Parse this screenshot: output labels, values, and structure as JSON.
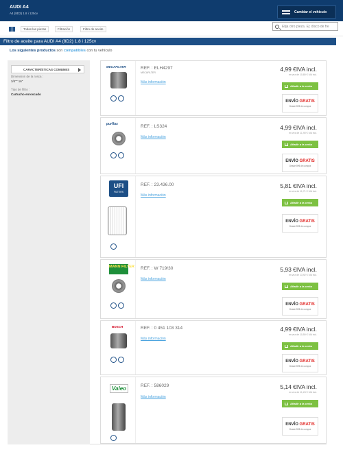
{
  "header": {
    "car_title": "AUDI A4",
    "car_subtitle": "A4 (8D2) 1.8 i 125cv",
    "change_vehicle_label": "Cambiar el vehículo"
  },
  "toolbar": {
    "chips": [
      "Todas las piezas",
      "Filtración",
      "Filtro de aceite"
    ],
    "search_placeholder": "Elija otro pieza. Ej: disco de fre"
  },
  "page_title": "Filtro de aceite para AUDI A4 (8D2) 1.8 i 125cv",
  "compat": {
    "prefix": "Los siguientes productos",
    "mid": "son",
    "highlight": "compatibles",
    "suffix": "con tu vehículo"
  },
  "sidebar": {
    "panel_title": "CARACTERÍSTICAS COMUNES",
    "specs": [
      {
        "label": "Dimensión de la rosca :",
        "value": "3/4\"\" 16\""
      },
      {
        "label": "Tipo de filtro :",
        "value": "Cartucho enroscado"
      }
    ]
  },
  "common_labels": {
    "more_info": "Más información",
    "add_to_cart": "Añadir a la cesta",
    "shipping_word": "ENVÍO",
    "shipping_free": "GRATIS",
    "shipping_note": "Desde 59€ de compra"
  },
  "products": [
    {
      "brand": "MECAFILTER",
      "ref": "REF. : ELH4297",
      "sub_brand": "MECAFILTER",
      "price": "4,99 €IVA incl.",
      "old_price": "en vez de 10,80 € IVA incl."
    },
    {
      "brand": "purflux",
      "ref": "REF. : LS324",
      "sub_brand": "",
      "price": "4,99 €IVA incl.",
      "old_price": "en vez de 11,90 € IVA incl."
    },
    {
      "brand": "UFI",
      "brand_sub": "FILTERS",
      "ref": "REF. : 23.436.00",
      "sub_brand": "",
      "price": "5,81 €IVA incl.",
      "old_price": "en vez de 11,71 € IVA incl."
    },
    {
      "brand": "MANN FILTER",
      "ref": "REF. : W 719/30",
      "sub_brand": "",
      "price": "5,93 €IVA incl.",
      "old_price": "en vez de 13,92 € IVA incl."
    },
    {
      "brand": "BOSCH",
      "ref": "REF. : 0 451 103 314",
      "sub_brand": "",
      "price": "4,99 €IVA incl.",
      "old_price": "en vez de 10,50 € IVA incl."
    },
    {
      "brand": "Valeo",
      "ref": "REF. : 586029",
      "sub_brand": "",
      "price": "5,14 €IVA incl.",
      "old_price": "en vez de 11,24 € IVA incl."
    }
  ],
  "colors": {
    "brand_navy": "#0f3c6e",
    "title_blue": "#1d4f86",
    "cart_green": "#7dc142",
    "free_red": "#e0221f",
    "link_blue": "#4aa3df"
  }
}
